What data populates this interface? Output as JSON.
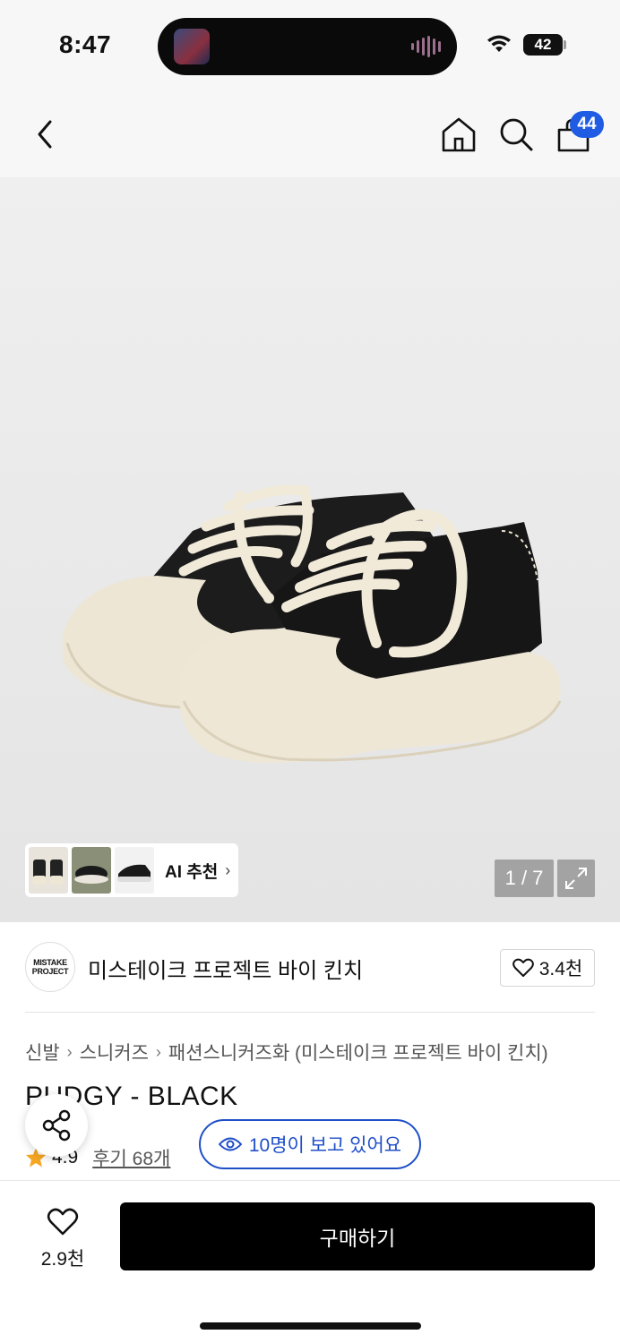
{
  "status": {
    "time": "8:47",
    "battery": "42"
  },
  "nav": {
    "cart_count": "44"
  },
  "hero": {
    "ai_label": "AI 추천",
    "page_counter": "1 / 7"
  },
  "brand": {
    "logo_text": "MISTAKE PROJECT",
    "name": "미스테이크 프로젝트 바이 킨치",
    "likes": "3.4천"
  },
  "breadcrumb": [
    "신발",
    "스니커즈",
    "패션스니커즈화 (미스테이크 프로젝트 바이 킨치)"
  ],
  "product": {
    "title": "PUDGY - BLACK",
    "rating": "4.9",
    "reviews": "후기 68개",
    "viewers": "10명이 보고 있어요"
  },
  "bottom": {
    "wish_count": "2.9천",
    "buy_label": "구매하기"
  },
  "colors": {
    "accent": "#1f5ce3",
    "viewers_border": "#1f4fc7",
    "star": "#f5a623",
    "buy_bg": "#000000"
  }
}
